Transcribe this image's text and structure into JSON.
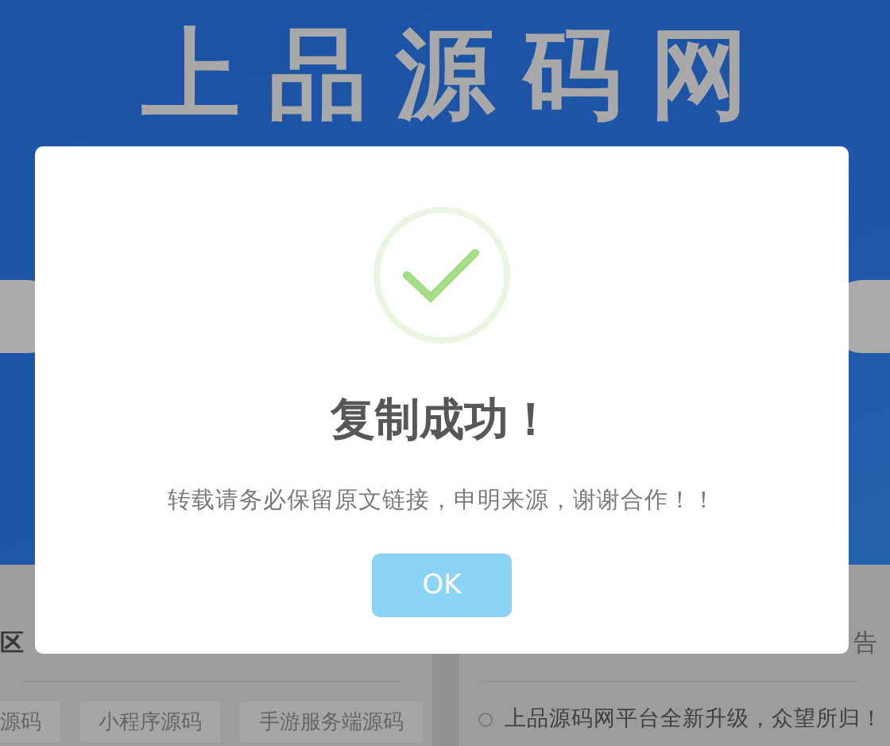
{
  "banner": {
    "title": "上品源码网"
  },
  "panels": [
    {
      "heading": "区",
      "kind": "tags",
      "items": [
        "源码",
        "小程序源码",
        "手游服务端源码"
      ]
    },
    {
      "heading": "告",
      "kind": "list",
      "items": [
        "上品源码网平台全新升级，众望所归！"
      ]
    }
  ],
  "dialog": {
    "kind": "success",
    "title": "复制成功！",
    "message": "转载请务必保留原文链接，申明来源，谢谢合作！！",
    "button": "OK"
  }
}
